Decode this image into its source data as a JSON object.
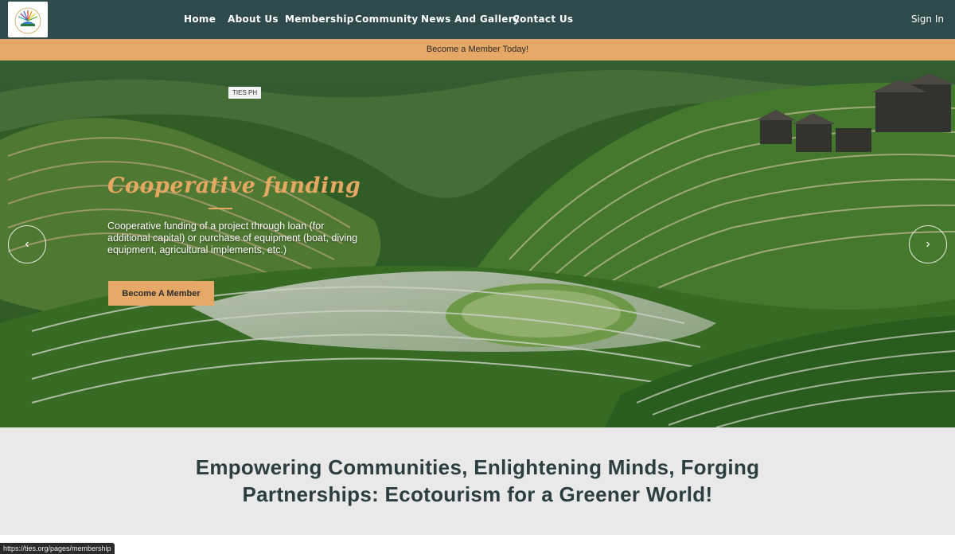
{
  "header": {
    "nav": [
      "Home",
      "About Us",
      "Membership",
      "Community",
      "News And Gallery",
      "Contact Us"
    ],
    "signin_label": "Sign In"
  },
  "announcement": {
    "text": "Become a Member Today!"
  },
  "hero": {
    "tag": "TIES PH",
    "title": "Cooperative funding",
    "body": "Cooperative funding of a project through loan (for additional capital) or purchase of equipment (boat, diving equipment, agricultural implements, etc.)",
    "cta_label": "Become A Member",
    "prev_icon": "‹",
    "next_icon": "›"
  },
  "tagline": {
    "line1": "Empowering Communities, Enlightening Minds, Forging",
    "line2": "Partnerships: Ecotourism for a Greener World!"
  },
  "status_bar": {
    "url": "https://ties.org/pages/membership"
  },
  "colors": {
    "header_bg": "#2e4a4d",
    "accent": "#e6a866",
    "tagline_bg": "#e9e9e9",
    "tagline_text": "#2c3e40"
  }
}
